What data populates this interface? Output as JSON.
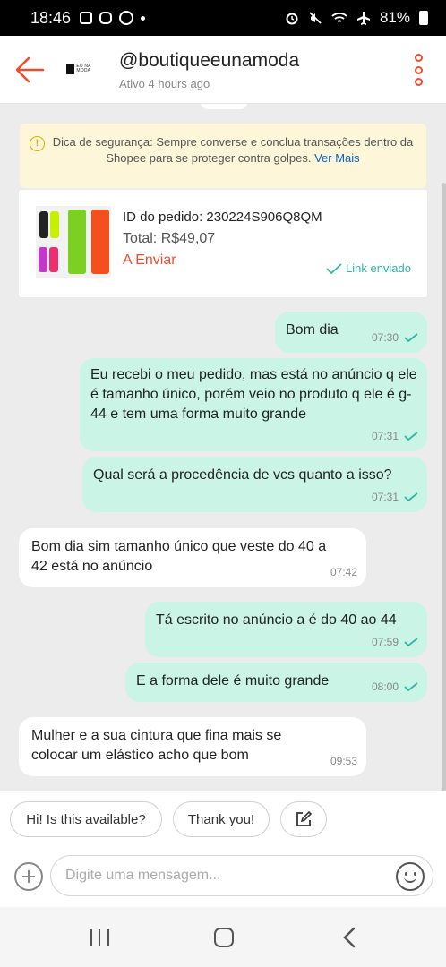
{
  "status_bar": {
    "time": "18:46",
    "battery": "81%"
  },
  "header": {
    "shop_name": "@boutiqueeunamoda",
    "status": "Ativo 4 hours ago",
    "logo_text": "EU NA MODA"
  },
  "safety_notice": {
    "text": "Dica de segurança: Sempre converse e conclua transações dentro da Shopee para se proteger contra golpes.",
    "link": "Ver Mais"
  },
  "order": {
    "id_label": "ID do pedido: 230224S906Q8QM",
    "total_label": "Total: R$49,07",
    "status": "A Enviar",
    "link_status": "Link enviado"
  },
  "messages": [
    {
      "dir": "out",
      "text": "Bom dia",
      "time": "07:30"
    },
    {
      "dir": "out",
      "text": "Eu recebi o meu pedido, mas está no anúncio q ele é tamanho único, porém veio no produto q ele é g-44 e tem uma forma muito grande",
      "time": "07:31"
    },
    {
      "dir": "out",
      "text": "Qual será a procedência de vcs quanto a isso?",
      "time": "07:31"
    },
    {
      "dir": "in",
      "text": "Bom dia sim tamanho único  que veste do 40 a 42 está no anúncio",
      "time": "07:42"
    },
    {
      "dir": "out",
      "text": "Tá escrito no anúncio a é do 40 ao 44",
      "time": "07:59"
    },
    {
      "dir": "out",
      "text": "E a forma dele é muito grande",
      "time": "08:00"
    },
    {
      "dir": "in",
      "text": "Mulher e a sua cintura que fina mais se colocar um elástico acho que bom",
      "time": "09:53"
    }
  ],
  "quick_replies": [
    "Hi! Is this available?",
    "Thank you!"
  ],
  "composer": {
    "placeholder": "Digite uma mensagem..."
  },
  "colors": {
    "brand": "#ee4d2d",
    "outgoing_bubble": "#c9f4e6",
    "check": "#2eb7a5",
    "link": "#0a5fd6"
  }
}
